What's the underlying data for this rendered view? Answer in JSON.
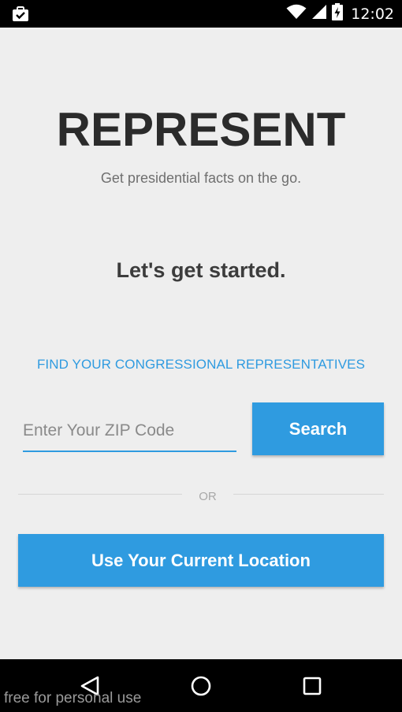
{
  "status_bar": {
    "time": "12:02",
    "icons": [
      "shopping-bag-icon",
      "wifi-icon",
      "cell-signal-icon",
      "battery-charging-icon"
    ]
  },
  "app": {
    "title": "REPRESENT",
    "tagline": "Get presidential facts on the go."
  },
  "main": {
    "heading": "Let's get started.",
    "section_label": "FIND YOUR CONGRESSIONAL REPRESENTATIVES",
    "zip_input": {
      "placeholder": "Enter Your ZIP Code",
      "value": ""
    },
    "search_button_label": "Search",
    "divider_text": "OR",
    "location_button_label": "Use Your Current Location"
  },
  "nav_bar": {
    "icons": [
      "back-icon",
      "home-icon",
      "recents-icon"
    ]
  },
  "watermark": "free for personal use",
  "colors": {
    "accent": "#2f9be0",
    "background": "#eeeeee",
    "title": "#2b2b2b"
  }
}
